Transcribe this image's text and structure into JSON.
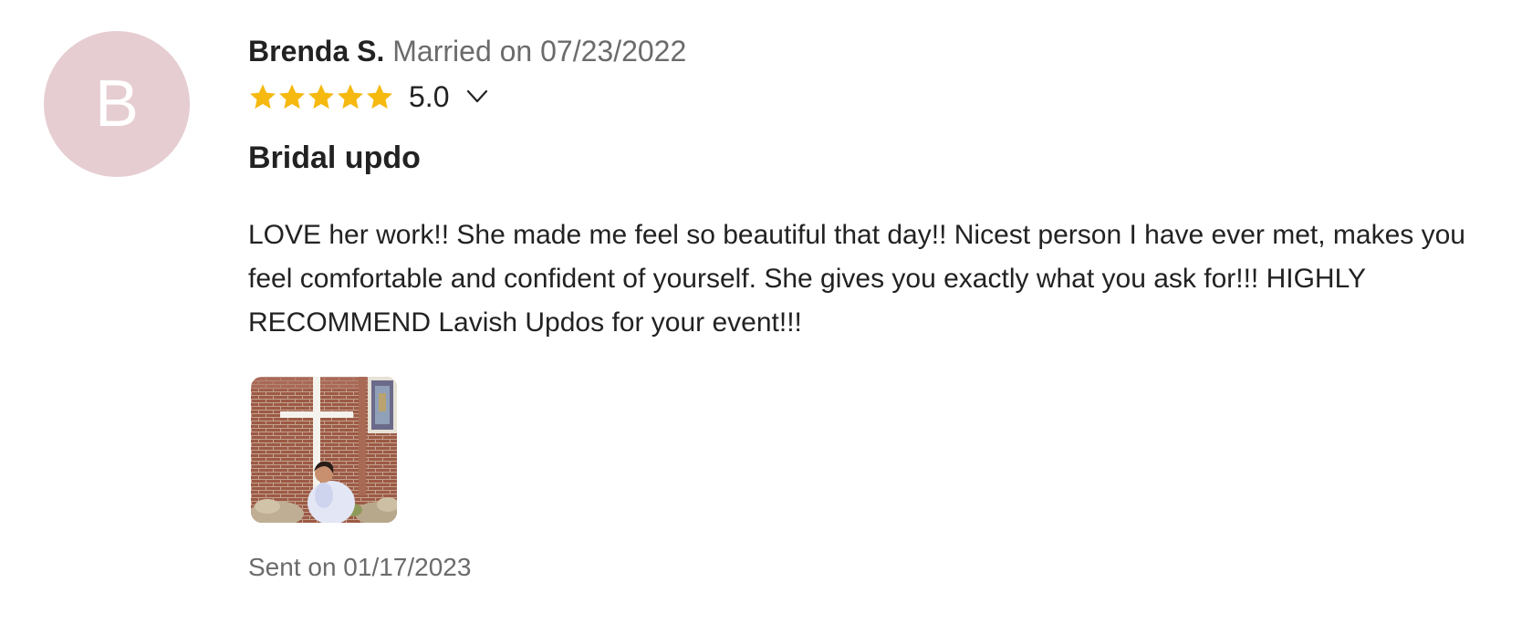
{
  "review": {
    "avatar": {
      "initial": "B",
      "background_color": "#e6cdd1"
    },
    "reviewer_name": "Brenda S.",
    "married_label": "Married on 07/23/2022",
    "rating": {
      "stars": 5,
      "value_text": "5.0",
      "star_color": "#f5b90f",
      "expand_icon": "chevron-down-icon"
    },
    "title": "Bridal updo",
    "body": "LOVE her work!! She made me feel so beautiful that day!! Nicest person I have ever met, makes you feel comfortable and confident of yourself. She gives you exactly what you ask for!!! HIGHLY RECOMMEND Lavish Updos for your event!!!",
    "photos": [
      {
        "icon": "photo-thumbnail"
      }
    ],
    "sent_label": "Sent on 01/17/2023"
  }
}
